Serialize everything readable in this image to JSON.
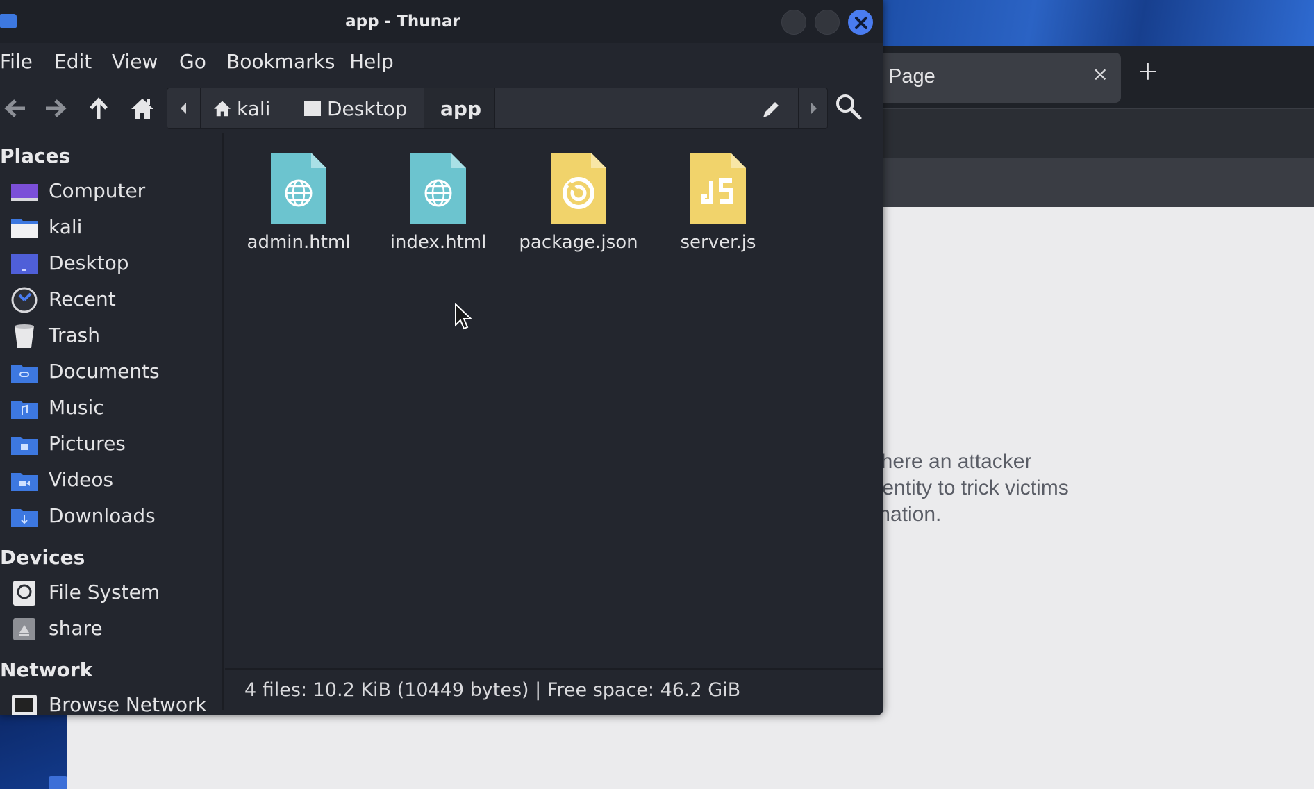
{
  "window": {
    "title": "app - Thunar"
  },
  "menubar": {
    "items": [
      "File",
      "Edit",
      "View",
      "Go",
      "Bookmarks",
      "Help"
    ]
  },
  "pathbar": {
    "segments": [
      "kali",
      "Desktop",
      "app"
    ],
    "current": "app"
  },
  "sidebar": {
    "places_heading": "Places",
    "places": [
      {
        "label": "Computer",
        "icon": "computer-icon"
      },
      {
        "label": "kali",
        "icon": "home-folder-icon"
      },
      {
        "label": "Desktop",
        "icon": "desktop-icon"
      },
      {
        "label": "Recent",
        "icon": "recent-icon"
      },
      {
        "label": "Trash",
        "icon": "trash-icon"
      },
      {
        "label": "Documents",
        "icon": "documents-folder-icon"
      },
      {
        "label": "Music",
        "icon": "music-folder-icon"
      },
      {
        "label": "Pictures",
        "icon": "pictures-folder-icon"
      },
      {
        "label": "Videos",
        "icon": "videos-folder-icon"
      },
      {
        "label": "Downloads",
        "icon": "downloads-folder-icon"
      }
    ],
    "devices_heading": "Devices",
    "devices": [
      {
        "label": "File System",
        "icon": "drive-icon"
      },
      {
        "label": "share",
        "icon": "network-share-icon"
      }
    ],
    "network_heading": "Network",
    "network": [
      {
        "label": "Browse Network",
        "icon": "network-icon"
      }
    ]
  },
  "files": [
    {
      "name": "admin.html",
      "icon": "html-file-icon",
      "color": "#6cc4cf"
    },
    {
      "name": "index.html",
      "icon": "html-file-icon",
      "color": "#6cc4cf"
    },
    {
      "name": "package.json",
      "icon": "json-file-icon",
      "color": "#f1d36b"
    },
    {
      "name": "server.js",
      "icon": "js-file-icon",
      "color": "#f1d36b"
    }
  ],
  "statusbar": {
    "text": "4 files: 10.2 KiB (10449 bytes)  |  Free space: 46.2 GiB"
  },
  "browser": {
    "tab_title": "Page",
    "tab_close": "×",
    "new_tab": "+",
    "content_lines": [
      "where an attacker",
      "y entity to trick victims",
      "rmation."
    ]
  },
  "colors": {
    "accent": "#4a7cf0",
    "window_bg": "#23262e",
    "html_icon": "#6cc4cf",
    "js_icon": "#f1d36b"
  }
}
